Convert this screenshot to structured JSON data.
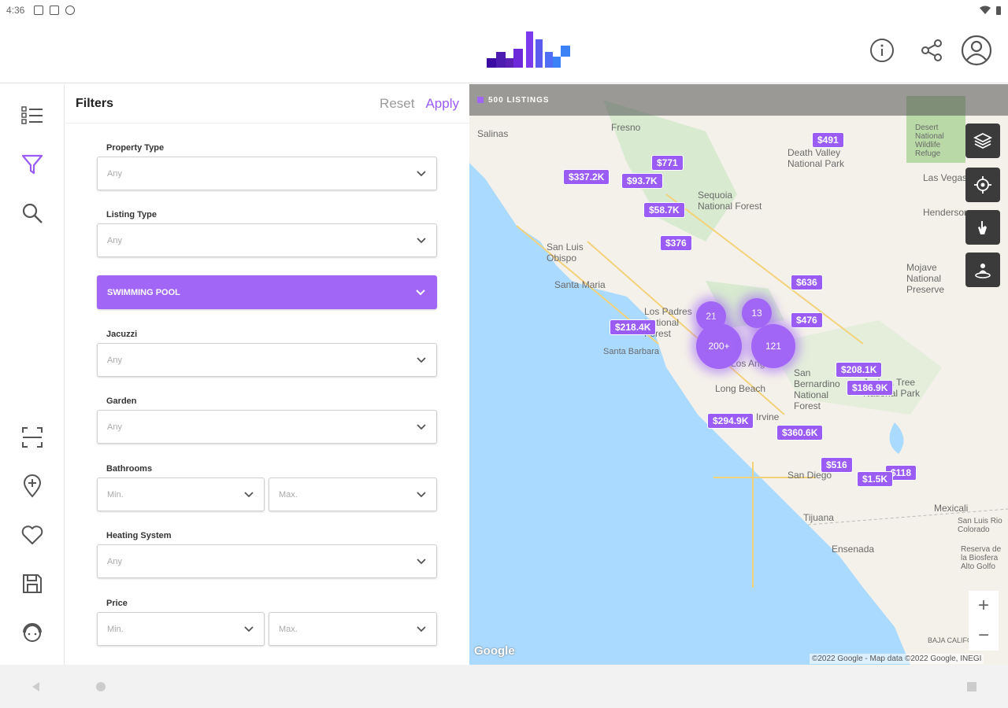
{
  "status": {
    "time": "4:36"
  },
  "header": {
    "brand_colors": [
      "#3a0ca3",
      "#7c3aed",
      "#3b82f6"
    ]
  },
  "filters": {
    "title": "Filters",
    "reset_label": "Reset",
    "apply_label": "Apply",
    "property_type": {
      "label": "Property Type",
      "value": "Any"
    },
    "listing_type": {
      "label": "Listing Type",
      "value": "Any"
    },
    "swimming_pool": {
      "label": "SWIMMING POOL"
    },
    "jacuzzi": {
      "label": "Jacuzzi",
      "value": "Any"
    },
    "garden": {
      "label": "Garden",
      "value": "Any"
    },
    "bathrooms": {
      "label": "Bathrooms",
      "min": "Min.",
      "max": "Max."
    },
    "heating_system": {
      "label": "Heating System",
      "value": "Any"
    },
    "price": {
      "label": "Price",
      "min": "Min.",
      "max": "Max."
    }
  },
  "map": {
    "listing_count": "500",
    "listing_suffix": "LISTINGS",
    "places": [
      "Fresno",
      "Salinas",
      "Sequoia National Forest",
      "San Luis Obispo",
      "Santa Maria",
      "Los Padres National Forest",
      "Santa Barbara",
      "Los Angeles",
      "Long Beach",
      "Irvine",
      "San Bernardino National Forest",
      "Joshua Tree National Park",
      "Death Valley National Park",
      "Mojave National Preserve",
      "Las Vegas",
      "Henderson",
      "San Diego",
      "Tijuana",
      "Mexicali",
      "Ensenada",
      "San Luis Rio Colorado",
      "Reserva de la Biosfera Alto Golfo",
      "BAJA CALIFORNIA",
      "Desert National Wildlife Refuge"
    ],
    "prices": [
      "$491",
      "$771",
      "$337.2K",
      "$93.7K",
      "$58.7K",
      "$376",
      "$636",
      "$476",
      "$218.4K",
      "$208.1K",
      "$186.9K",
      "$294.9K",
      "$360.6K",
      "$516",
      "$1.5K",
      "$118"
    ],
    "clusters": [
      "21",
      "13",
      "200+",
      "121"
    ],
    "google": "Google",
    "attribution": "©2022 Google - Map data ©2022 Google, INEGI"
  }
}
